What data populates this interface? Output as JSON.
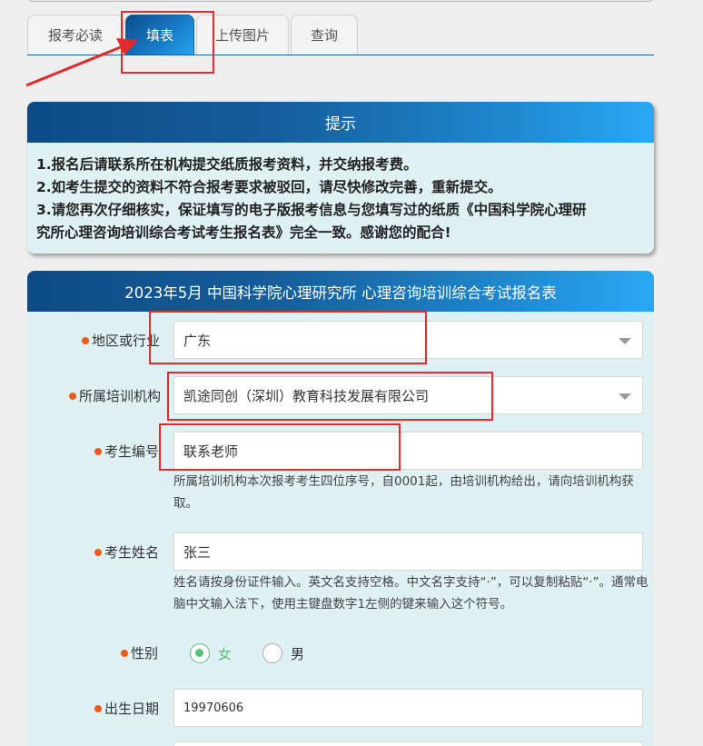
{
  "tabs": [
    {
      "label": "报考必读"
    },
    {
      "label": "填表"
    },
    {
      "label": "上传图片"
    },
    {
      "label": "查询"
    }
  ],
  "notice": {
    "title": "提示",
    "lines": [
      "1.报名后请联系所在机构提交纸质报考资料，并交纳报考费。",
      "2.如考生提交的资料不符合报考要求被驳回，请尽快修改完善，重新提交。",
      "3.请您再次仔细核实，保证填写的电子版报考信息与您填写过的纸质《中国科学院心理研",
      "究所心理咨询培训综合考试考生报名表》完全一致。感谢您的配合!"
    ]
  },
  "form": {
    "title": "2023年5月 中国科学院心理研究所 心理咨询培训综合考试报名表",
    "region": {
      "label": "地区或行业",
      "value": "广东"
    },
    "institution": {
      "label": "所属培训机构",
      "value": "凯途同创（深圳）教育科技发展有限公司"
    },
    "exam_number": {
      "label": "考生编号",
      "value": "联系老师",
      "hint": "所属培训机构本次报考考生四位序号，自0001起，由培训机构给出，请向培训机构获取。"
    },
    "name": {
      "label": "考生姓名",
      "value": "张三",
      "hint": "姓名请按身份证件输入。英文名支持空格。中文名字支持“·”，可以复制粘贴“·”。通常电脑中文输入法下，使用主键盘数字1左侧的键来输入这个符号。"
    },
    "gender": {
      "label": "性别",
      "options": [
        {
          "label": "女",
          "selected": true
        },
        {
          "label": "男",
          "selected": false
        }
      ]
    },
    "birth_date": {
      "label": "出生日期",
      "value": "19970606"
    }
  },
  "colors": {
    "accent_dot": "#f05a1c",
    "highlight": "#e8282b",
    "panel_bg": "#dff1f2",
    "radio_selected": "#5cbf7a"
  }
}
